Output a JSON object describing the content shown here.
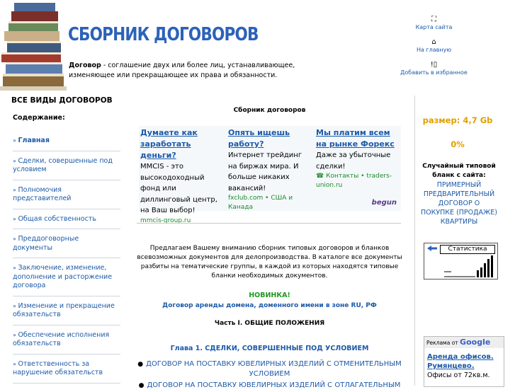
{
  "header": {
    "site_title": "СБОРНИК ДОГОВОРОВ",
    "definition_term": "Договор",
    "definition_text": " - соглашение двух или более лиц, устанавливающее, изменяющее или прекращающее их права и обязанности."
  },
  "top_links": [
    {
      "icon": "sitemap-icon",
      "label": "Карта сайта"
    },
    {
      "icon": "home-icon",
      "label": "На главную"
    },
    {
      "icon": "bookmark-icon",
      "label": "Добавить в избранное"
    }
  ],
  "left": {
    "heading": "ВСЕ ВИДЫ ДОГОВОРОВ",
    "toc_label": "Содержание:",
    "items": [
      {
        "label": "Главная"
      },
      {
        "label": "Сделки, совершенные под условием"
      },
      {
        "label": "Полномочия представителей"
      },
      {
        "label": "Общая собственность"
      },
      {
        "label": "Преддоговорные документы"
      },
      {
        "label": "Заключение, изменение, дополнение и расторжение договора"
      },
      {
        "label": "Изменение и прекращение обязательств"
      },
      {
        "label": "Обеспечение исполнения обязательств"
      },
      {
        "label": "Ответственность за нарушение обязательств"
      }
    ]
  },
  "center": {
    "title": "Сборник договоров",
    "ads": [
      {
        "head": "Думаете как заработать деньги?",
        "body": "MMCIS - это высокодоходный фонд или диллинговый центр, на Ваш выбор!",
        "domain": "mmcis-group.ru"
      },
      {
        "head": "Опять ищешь работу?",
        "body": "Интернет трейдинг на биржах мира. И больше никаких вакансий!",
        "domain": "fxclub.com • США и Канада"
      },
      {
        "head": "Мы платим всем на рынке Форекс",
        "body": "Даже за убыточные сделки!",
        "domain": "Контакты • traders-union.ru"
      }
    ],
    "begun": "begun",
    "intro": "Предлагаем Вашему вниманию сборник типовых договоров и бланков всевозможных документов для делопроизводства. В каталоге все документы разбиты на тематические группы, в каждой из которых находятся типовые бланки необходимых документов.",
    "novinka": "НОВИНКА!",
    "novinka_link": "Договор аренды домена, доменного имени в зоне RU, РФ",
    "part": "Часть I. ОБЩИЕ ПОЛОЖЕНИЯ",
    "chapter": "Глава 1. СДЕЛКИ, СОВЕРШЕННЫЕ ПОД УСЛОВИЕМ",
    "contracts": [
      "ДОГОВОР НА ПОСТАВКУ ЮВЕЛИРНЫХ ИЗДЕЛИЙ С ОТМЕНИТЕЛЬНЫМ УСЛОВИЕМ",
      "ДОГОВОР НА ПОСТАВКУ ЮВЕЛИРНЫХ ИЗДЕЛИЙ С ОТЛАГАТЕЛЬНЫМ"
    ]
  },
  "right": {
    "size": "размер: 4,7 Gb",
    "percent": "0%",
    "random_head": "Случайный типовой бланк с сайта:",
    "random_link": "ПРИМЕРНЫЙ ПРЕДВАРИТЕЛЬНЫЙ ДОГОВОР О ПОКУПКЕ (ПРОДАЖЕ) КВАРТИРЫ",
    "stat_label": "Статистика",
    "ad_prefix": "Реклама от",
    "ad_brand": "Google",
    "ad_title": "Аренда офисов. Румянцево.",
    "ad_text": "Офисы от 72кв.м."
  },
  "colors": {
    "link": "#1c5aa8",
    "accent": "#e0a000",
    "new": "#1f9a1f"
  }
}
